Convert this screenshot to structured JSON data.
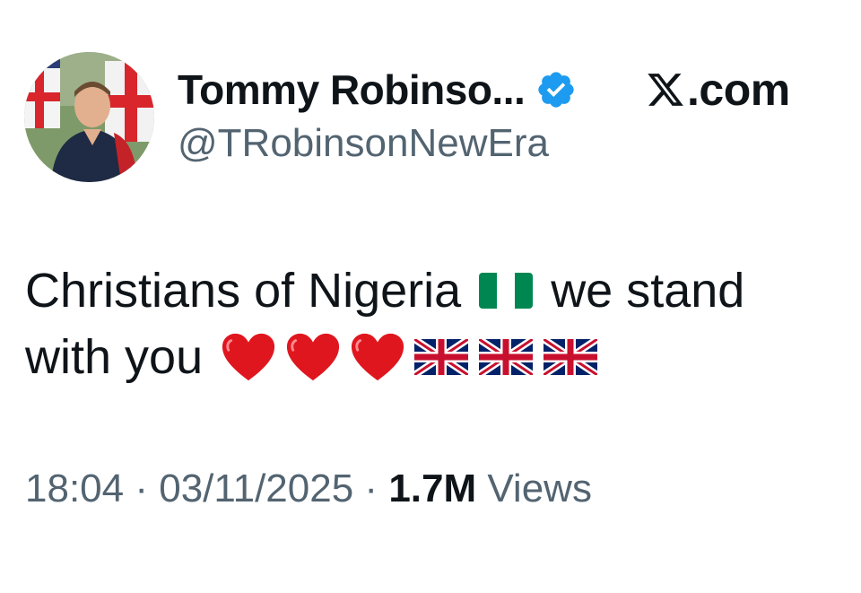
{
  "author": {
    "display_name": "Tommy Robinso...",
    "handle": "@TRobinsonNewEra",
    "verified": true,
    "avatar_icon": "profile-photo"
  },
  "brand": {
    "label": ".com",
    "icon": "x-logo-icon"
  },
  "tweet": {
    "line1_part1": "Christians of Nigeria",
    "line1_part2": "we stand",
    "line2_part1": "with you",
    "emojis": [
      "nigeria-flag-icon",
      "red-heart-icon",
      "red-heart-icon",
      "red-heart-icon",
      "uk-flag-icon",
      "uk-flag-icon",
      "uk-flag-icon"
    ]
  },
  "meta": {
    "time": "18:04",
    "separator": "·",
    "date": "03/11/2025",
    "views_count": "1.7M",
    "views_label": "Views"
  },
  "colors": {
    "text": "#0f1419",
    "secondary": "#536471",
    "verified_blue": "#1d9bf0",
    "heart_red": "#e0161f",
    "nigeria_green": "#008751"
  }
}
